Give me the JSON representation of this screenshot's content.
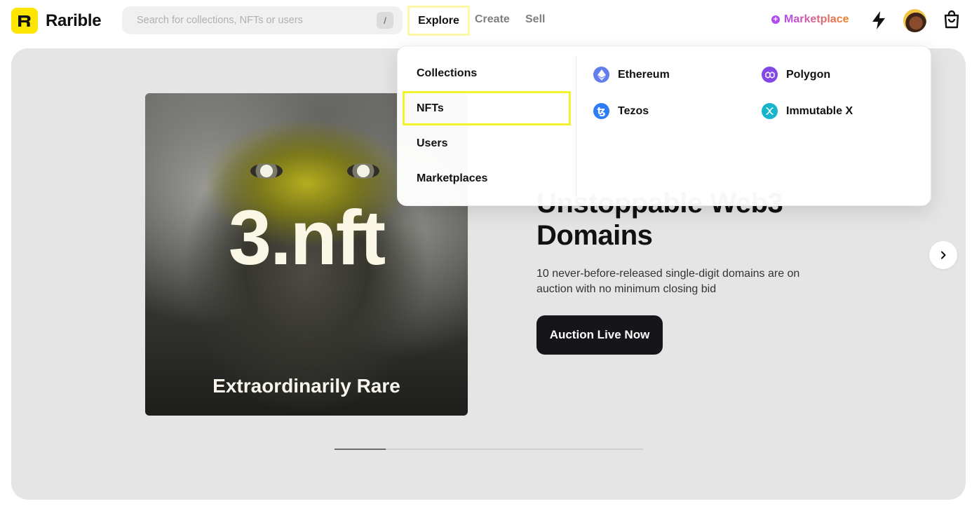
{
  "brand": {
    "name": "Rarible"
  },
  "search": {
    "placeholder": "Search for collections, NFTs or users",
    "shortcut": "/"
  },
  "nav": {
    "explore": "Explore",
    "create": "Create",
    "sell": "Sell"
  },
  "header_right": {
    "marketplace_label": "Marketplace"
  },
  "explore_menu": {
    "categories": [
      "Collections",
      "NFTs",
      "Users",
      "Marketplaces"
    ],
    "selected_category": "NFTs",
    "chains": [
      {
        "name": "Ethereum",
        "icon": "ethereum-icon",
        "color": "#627eea"
      },
      {
        "name": "Polygon",
        "icon": "polygon-icon",
        "color": "#8247e5"
      },
      {
        "name": "Tezos",
        "icon": "tezos-icon",
        "color": "#2c7df7"
      },
      {
        "name": "Immutable X",
        "icon": "immutable-x-icon",
        "color": "#17b5cb"
      }
    ]
  },
  "hero": {
    "art_title": "3.nft",
    "art_caption": "Extraordinarily Rare",
    "heading": "Unstoppable Web3 Domains",
    "description": "10 never-before-released single-digit domains are on auction with no minimum closing bid",
    "cta_label": "Auction Live Now",
    "slide_progress": 0.166
  },
  "colors": {
    "brand_yellow": "#fee600",
    "marketplace_gradient": [
      "#b549f3",
      "#f7811d"
    ],
    "cta_bg": "#16161a"
  }
}
